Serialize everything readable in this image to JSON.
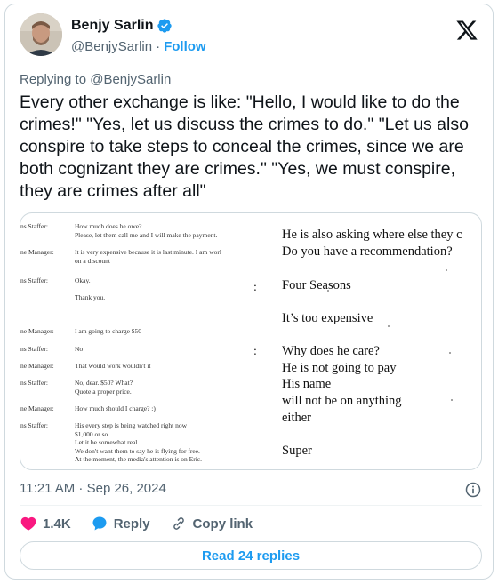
{
  "author": {
    "name": "Benjy Sarlin",
    "handle": "@BenjySarlin",
    "separator": "·",
    "follow_label": "Follow"
  },
  "reply": {
    "prefix": "Replying to ",
    "handle": "@BenjySarlin"
  },
  "tweet": {
    "text": "Every other exchange is like: \"Hello, I would like to do the crimes!\" \"Yes, let us discuss the crimes to do.\" \"Let us also conspire to take steps to conceal the crimes, since we are both cognizant they are crimes.\" \"Yes, we must conspire, they are crimes after all\""
  },
  "media": {
    "left_rows": [
      {
        "role": "ns Staffer:",
        "message": "How much does he owe?\nPlease, let them call me and I will make the payment."
      },
      {
        "role": "ne Manager:",
        "message": "It is very expensive because it is last minute.  I am worl\non a discount"
      },
      {
        "role": "ns Staffer:",
        "message": "Okay."
      },
      {
        "role": "",
        "message": "Thank you."
      },
      {
        "role": "ne Manager:",
        "message": "I am going to charge $50"
      },
      {
        "role": "ns Staffer:",
        "message": "No"
      },
      {
        "role": "ne Manager:",
        "message": "That would work wouldn't it"
      },
      {
        "role": "ns Staffer:",
        "message": "No, dear.  $50?  What?\nQuote a proper price."
      },
      {
        "role": "ne Manager:",
        "message": "How much should I charge? :)"
      },
      {
        "role": "ns Staffer:",
        "message": "His every step is being watched right now\n$1,000 or so\nLet it be somewhat real.\nWe don't want them to say he is flying for free.\nAt the moment, the media's attention is on Eric."
      }
    ],
    "right_lines": [
      "He is also asking where else they c",
      "Do you have a recommendation?",
      "Four Seasons",
      "It’s too expensive",
      "Why does he care?",
      "He is not going to pay",
      "His name",
      "will not be on anything",
      "either",
      "Super"
    ],
    "colons": [
      ":",
      ":"
    ]
  },
  "meta": {
    "timestamp": "11:21 AM · Sep 26, 2024"
  },
  "actions": {
    "likes": "1.4K",
    "reply_label": "Reply",
    "copy_link_label": "Copy link"
  },
  "read_replies_label": "Read 24 replies",
  "colors": {
    "accent": "#1d9bf0",
    "like": "#f91880",
    "muted": "#536471",
    "border": "#cfd9de"
  },
  "icons": [
    "verified-badge-icon",
    "x-logo-icon",
    "info-icon",
    "heart-icon",
    "reply-bubble-icon",
    "link-icon"
  ]
}
